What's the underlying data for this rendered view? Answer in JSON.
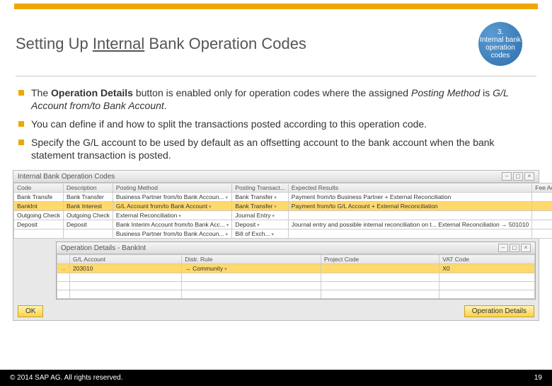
{
  "header": {
    "title_pre": "Setting Up ",
    "title_u": "Internal",
    "title_post": " Bank Operation Codes"
  },
  "step": {
    "num": "3.",
    "label": "Internal bank operation codes"
  },
  "bullets": [
    {
      "html": "The <b>Operation Details</b> button is enabled only for operation codes where the assigned <i>Posting Method</i> is <i>G/L Account from/to Bank Account</i>."
    },
    {
      "text": "You can define if and how to split the transactions posted according to this operation code."
    },
    {
      "text": "Specify the G/L account to be used by default as an offsetting account to the bank account when the bank statement transaction is posted."
    }
  ],
  "panel": {
    "title": "Internal Bank Operation Codes",
    "cols": [
      "Code",
      "Description",
      "Posting Method",
      "Posting Transact...",
      "Expected Results",
      "Fee Account"
    ],
    "rows": [
      {
        "c": [
          "Bank Transfe",
          "Bank Transfer",
          "Business Partner from/to Bank Accoun...",
          "Bank Transfer",
          "Payment from/to Business Partner + External Reconciliation",
          ""
        ],
        "sel": false
      },
      {
        "c": [
          "BankInt",
          "Bank Interest",
          "G/L Account from/to Bank Account",
          "Bank Transfer",
          "Payment from/to G/L Account + External Reconciliation",
          ""
        ],
        "sel": true
      },
      {
        "c": [
          "Outgoing Check",
          "Outgoing Check",
          "External Reconciliation",
          "Journal Entry",
          "",
          ""
        ],
        "sel": false
      },
      {
        "c": [
          "Deposit",
          "Deposit",
          "Bank Interim Account from/to Bank Acc...",
          "Deposit",
          "Journal entry and possible internal reconciliation on t...  External Reconciliation   → 501010",
          ""
        ],
        "sel": false
      },
      {
        "c": [
          "",
          "",
          "Business Partner from/to Bank Accoun...",
          "Bill of Exch...",
          "",
          ""
        ],
        "sel": false
      }
    ]
  },
  "subpanel": {
    "title": "Operation Details - BankInt",
    "cols": [
      "",
      "G/L Account",
      "Distr. Rule",
      "Project Code",
      "VAT Code"
    ],
    "row_arrow": "→",
    "row_acct": "203010",
    "row_rule": "→ Community",
    "row_vat": "X0"
  },
  "buttons": {
    "ok": "OK",
    "opdetails": "Operation Details"
  },
  "footer": {
    "copyright": "© 2014 SAP AG. All rights reserved.",
    "page": "19"
  }
}
